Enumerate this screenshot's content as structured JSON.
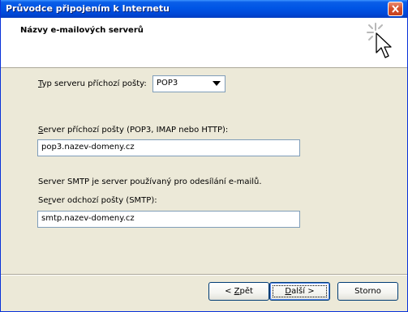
{
  "window": {
    "title": "Průvodce připojením k Internetu"
  },
  "header": {
    "title": "Názvy e-mailových serverů"
  },
  "form": {
    "server_type": {
      "label_mnemonic": "T",
      "label_rest": "yp serveru příchozí pošty:",
      "value": "POP3"
    },
    "incoming": {
      "label_mnemonic": "S",
      "label_rest": "erver příchozí pošty (POP3, IMAP nebo HTTP):",
      "value": "pop3.nazev-domeny.cz"
    },
    "smtp_note": "Server SMTP je server používaný pro odesílání e-mailů.",
    "outgoing": {
      "label_prefix": "Se",
      "label_mnemonic": "r",
      "label_rest": "ver odchozí pošty (SMTP):",
      "value": "smtp.nazev-domeny.cz"
    }
  },
  "buttons": {
    "back_prefix": "< ",
    "back_mnemonic": "Z",
    "back_rest": "pět",
    "next_mnemonic": "D",
    "next_rest": "alší >",
    "cancel": "Storno"
  },
  "colors": {
    "titlebar": "#0055e5",
    "dialog_bg": "#ece9d8",
    "input_border": "#7f9db9",
    "button_border": "#003c74"
  },
  "icons": {
    "close": "close-icon",
    "wizard": "wizard-sparkle-cursor-icon",
    "dropdown": "chevron-down-icon"
  }
}
